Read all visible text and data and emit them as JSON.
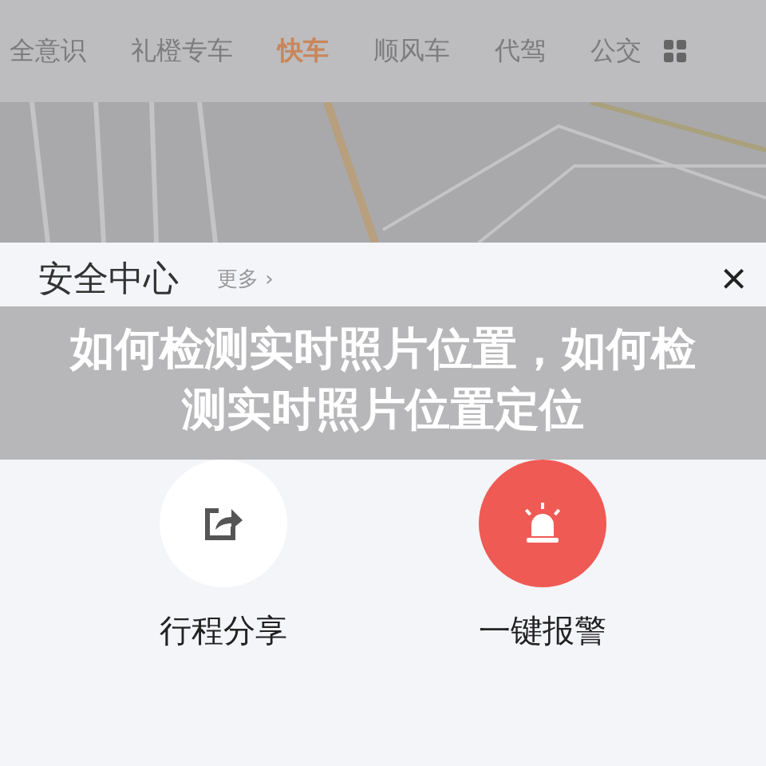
{
  "tabs": [
    {
      "label": "全意识",
      "selected": false
    },
    {
      "label": "礼橙专车",
      "selected": false
    },
    {
      "label": "快车",
      "selected": true
    },
    {
      "label": "顺风车",
      "selected": false
    },
    {
      "label": "代驾",
      "selected": false
    },
    {
      "label": "公交",
      "selected": false
    }
  ],
  "sheet": {
    "close": "×",
    "title": "安全中心",
    "more": "更多 ›",
    "actions": [
      {
        "kind": "share",
        "label": "行程分享"
      },
      {
        "kind": "alarm",
        "label": "一键报警"
      }
    ]
  },
  "caption_overlay": "如何检测实时照片位置，如何检测实时照片位置定位"
}
